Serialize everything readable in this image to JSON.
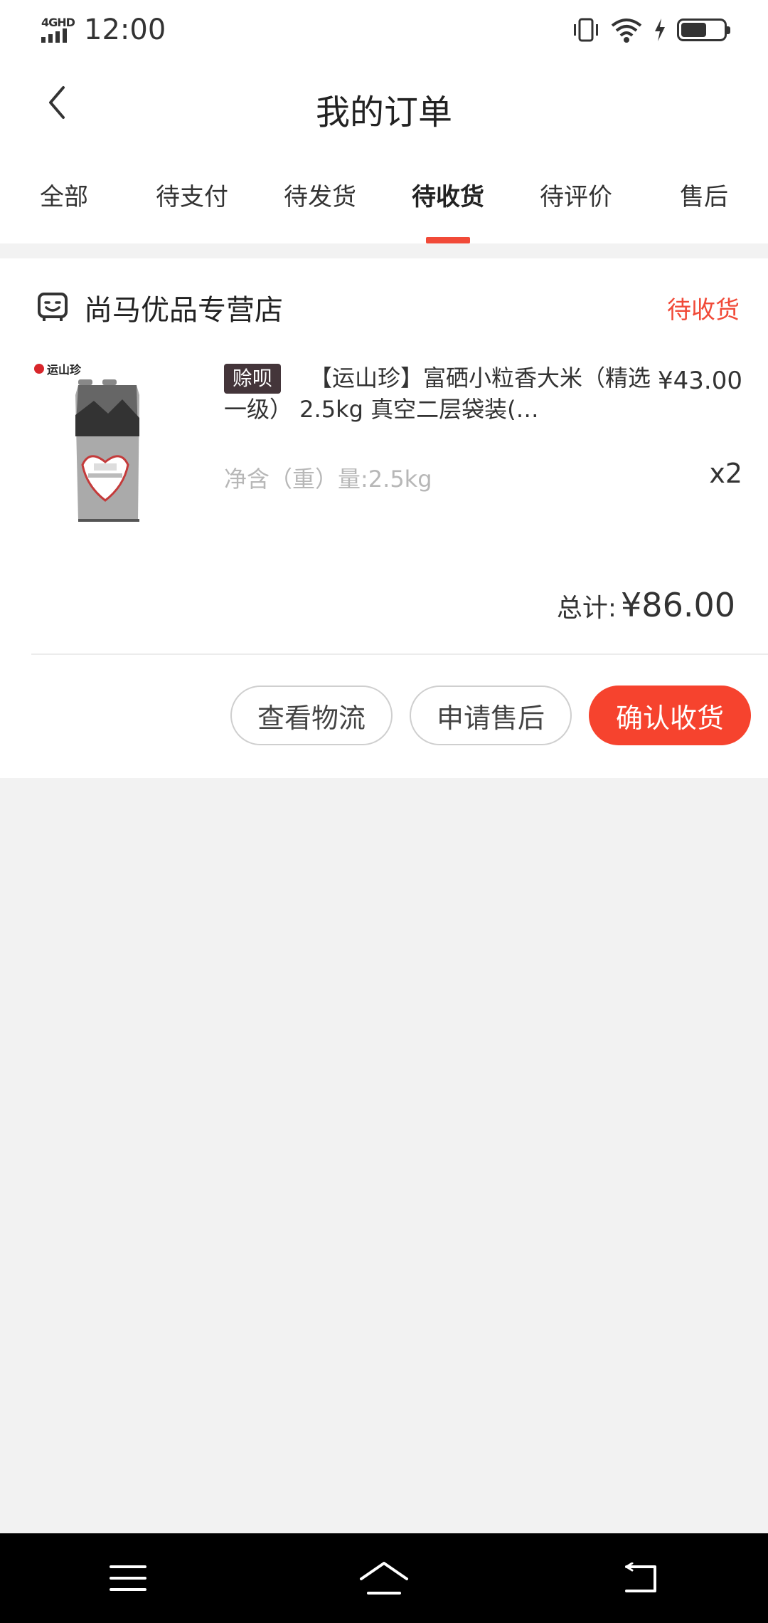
{
  "status_bar": {
    "network": "4GHD",
    "time": "12:00",
    "icons": [
      "vibrate-icon",
      "wifi-icon",
      "charging-icon",
      "battery-icon"
    ]
  },
  "header": {
    "title": "我的订单",
    "back_icon": "chevron-left-icon"
  },
  "tabs": [
    {
      "label": "全部",
      "active": false
    },
    {
      "label": "待支付",
      "active": false
    },
    {
      "label": "待发货",
      "active": false
    },
    {
      "label": "待收货",
      "active": true
    },
    {
      "label": "待评价",
      "active": false
    },
    {
      "label": "售后",
      "active": false
    }
  ],
  "order": {
    "shop_name": "尚马优品专营店",
    "shop_icon": "store-icon",
    "status": "待收货",
    "product": {
      "tag": "赊呗",
      "title": "【运山珍】富硒小粒香大米（精选一级） 2.5kg 真空二层袋装(…",
      "price": "¥43.00",
      "spec": "净含（重）量:2.5kg",
      "quantity": "x2",
      "image_brand_text": "运山珍"
    },
    "total_label": "总计:",
    "total_value": "¥86.00",
    "actions": {
      "logistics": "查看物流",
      "after_sale": "申请售后",
      "confirm": "确认收货"
    }
  },
  "colors": {
    "accent": "#f14a38",
    "primary_button": "#f6432e",
    "tag_bg": "#44353a",
    "page_bg": "#f2f2f2"
  },
  "nav_bar": {
    "icons": [
      "menu-icon",
      "home-icon",
      "back-icon"
    ]
  }
}
